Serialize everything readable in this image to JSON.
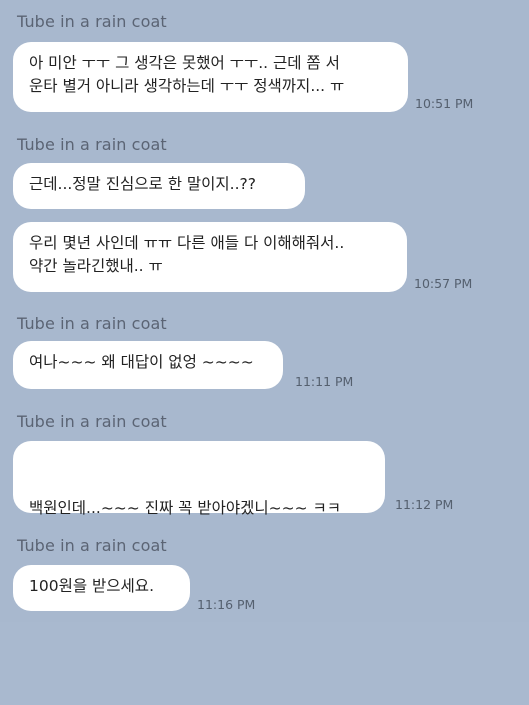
{
  "conversation": {
    "sender_name": "Tube in a rain coat",
    "groups": [
      {
        "sender": "Tube in a rain coat",
        "messages": [
          {
            "text": "아 미안 ㅜㅜ 그 생각은 못했어 ㅜㅜ.. 근데 쫌 서\n운타 별거 아니라 생각하는데 ㅜㅜ 정색까지... ㅠ",
            "time": "10:51 PM"
          }
        ]
      },
      {
        "sender": "Tube in a rain coat",
        "messages": [
          {
            "text": "근데...정말 진심으로 한 말이지..??",
            "time": ""
          },
          {
            "text": "우리 몇년 사인데 ㅠㅠ 다른 애들 다 이해해줘서..\n약간 놀라긴했내.. ㅠ",
            "time": "10:57 PM"
          }
        ]
      },
      {
        "sender": "Tube in a rain coat",
        "messages": [
          {
            "text": "여나~~~ 왜 대답이 없엉 ~~~~",
            "time": "11:11 PM"
          }
        ]
      },
      {
        "sender": "Tube in a rain coat",
        "messages": [
          {
            "text": "백원인데...~~~ 진짜 꼭 받아야겠니~~~ ㅋㅋ",
            "time": "11:12 PM",
            "emojis": [
              "laughing-crying-emoji",
              "person-emoji"
            ]
          }
        ]
      },
      {
        "sender": "Tube in a rain coat",
        "messages": [
          {
            "text": "100원을 받으세요.",
            "time": "11:16 PM"
          }
        ]
      }
    ]
  }
}
